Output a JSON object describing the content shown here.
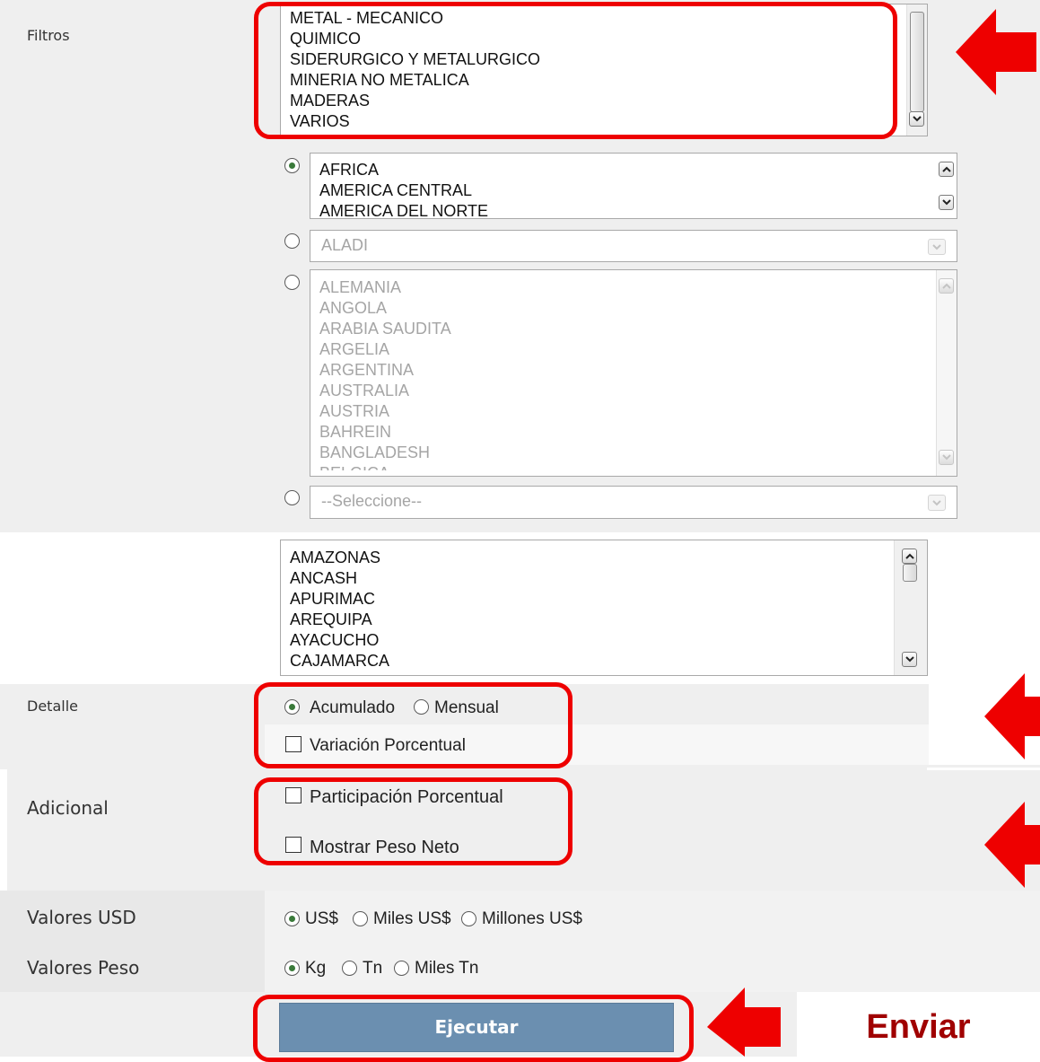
{
  "filtros": {
    "label": "Filtros",
    "sector_list": [
      "METAL - MECANICO",
      "QUIMICO",
      "SIDERURGICO Y METALURGICO",
      "MINERIA NO METALICA",
      "MADERAS",
      "VARIOS"
    ]
  },
  "region": {
    "continent_list": [
      "AFRICA",
      "AMERICA CENTRAL",
      "AMERICA DEL NORTE"
    ],
    "bloc_select": "ALADI",
    "country_list": [
      "ALEMANIA",
      "ANGOLA",
      "ARABIA SAUDITA",
      "ARGELIA",
      "ARGENTINA",
      "AUSTRALIA",
      "AUSTRIA",
      "BAHREIN",
      "BANGLADESH",
      "BELGICA"
    ],
    "other_select": "--Seleccione--"
  },
  "departamentos": {
    "list": [
      "AMAZONAS",
      "ANCASH",
      "APURIMAC",
      "AREQUIPA",
      "AYACUCHO",
      "CAJAMARCA"
    ]
  },
  "detalle": {
    "label": "Detalle",
    "acumulado": "Acumulado",
    "mensual": "Mensual",
    "variacion": "Variación Porcentual"
  },
  "adicional": {
    "label": "Adicional",
    "participacion": "Participación Porcentual",
    "peso_neto": "Mostrar Peso Neto"
  },
  "valores_usd": {
    "label": "Valores USD",
    "opt1": "US$",
    "opt2": "Miles US$",
    "opt3": "Millones US$"
  },
  "valores_peso": {
    "label": "Valores Peso",
    "opt1": "Kg",
    "opt2": "Tn",
    "opt3": "Miles Tn"
  },
  "actions": {
    "execute_label": "Ejecutar",
    "enviar_label": "Enviar"
  },
  "colors": {
    "highlight": "#ee0000",
    "button": "#6b8fb0",
    "band": "#efefef"
  }
}
